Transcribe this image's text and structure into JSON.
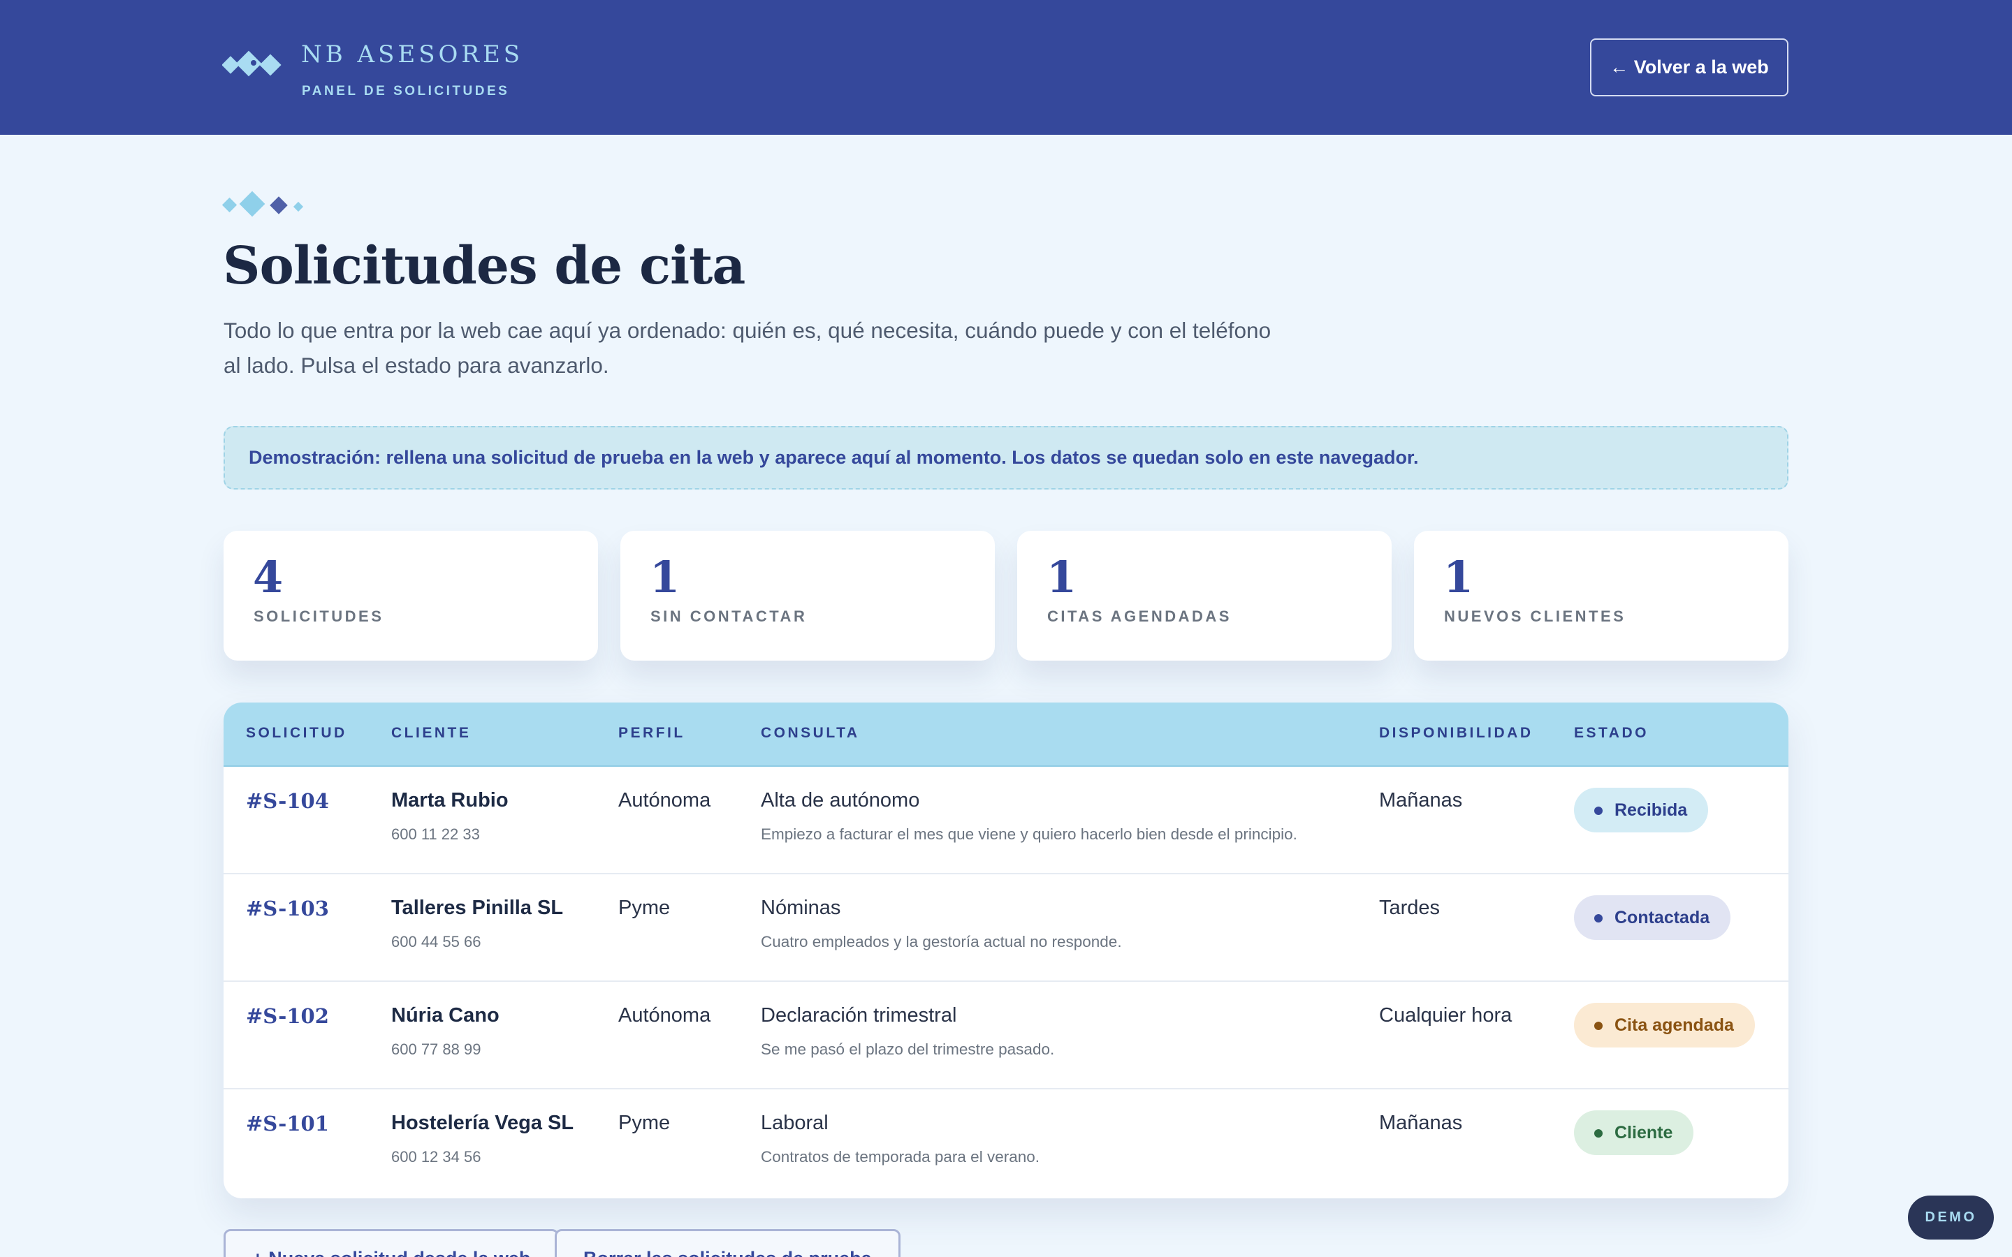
{
  "header": {
    "brand_name": "NB ASESORES",
    "brand_sub": "PANEL DE SOLICITUDES",
    "back_label": "← Volver a la web"
  },
  "main": {
    "title": "Solicitudes de cita",
    "intro": "Todo lo que entra por la web cae aquí ya ordenado: quién es, qué necesita, cuándo puede y con el teléfono al lado. Pulsa el estado para avanzarlo.",
    "notice": "Demostración: rellena una solicitud de prueba en la web y aparece aquí al momento. Los datos se quedan solo en este navegador."
  },
  "stats": [
    {
      "value": "4",
      "label": "SOLICITUDES"
    },
    {
      "value": "1",
      "label": "SIN CONTACTAR"
    },
    {
      "value": "1",
      "label": "CITAS AGENDADAS"
    },
    {
      "value": "1",
      "label": "NUEVOS CLIENTES"
    }
  ],
  "table": {
    "columns": [
      "SOLICITUD",
      "CLIENTE",
      "PERFIL",
      "CONSULTA",
      "DISPONIBILIDAD",
      "ESTADO"
    ],
    "rows": [
      {
        "id": "#S-104",
        "name": "Marta Rubio",
        "phone": "600 11 22 33",
        "profile": "Autónoma",
        "topic": "Alta de autónomo",
        "detail": "Empiezo a facturar el mes que viene y quiero hacerlo bien desde el principio.",
        "availability": "Mañanas",
        "status": "Recibida"
      },
      {
        "id": "#S-103",
        "name": "Talleres Pinilla SL",
        "phone": "600 44 55 66",
        "profile": "Pyme",
        "topic": "Nóminas",
        "detail": "Cuatro empleados y la gestoría actual no responde.",
        "availability": "Tardes",
        "status": "Contactada"
      },
      {
        "id": "#S-102",
        "name": "Núria Cano",
        "phone": "600 77 88 99",
        "profile": "Autónoma",
        "topic": "Declaración trimestral",
        "detail": "Se me pasó el plazo del trimestre pasado.",
        "availability": "Cualquier hora",
        "status": "Cita agendada"
      },
      {
        "id": "#S-101",
        "name": "Hostelería Vega SL",
        "phone": "600 12 34 56",
        "profile": "Pyme",
        "topic": "Laboral",
        "detail": "Contratos de temporada para el verano.",
        "availability": "Mañanas",
        "status": "Cliente"
      }
    ]
  },
  "status_colors": {
    "Recibida": {
      "bg": "#d3ecf5",
      "fg": "#2d3f8c",
      "dot": "#35489b"
    },
    "Contactada": {
      "bg": "#e1e4f3",
      "fg": "#2d3f8c",
      "dot": "#35489b"
    },
    "Cita agendada": {
      "bg": "#fbead3",
      "fg": "#8a5312",
      "dot": "#8a5312"
    },
    "Cliente": {
      "bg": "#dcefe1",
      "fg": "#2c6b41",
      "dot": "#2c6b41"
    }
  },
  "actions": {
    "new_label": "+ Nueva solicitud desde la web",
    "clear_label": "Borrar las solicitudes de prueba"
  },
  "demo_label": "DEMO",
  "colors": {
    "header_bg": "#35489b",
    "accent_light": "#a9dcf2",
    "page_bg": "#eef6fd"
  }
}
